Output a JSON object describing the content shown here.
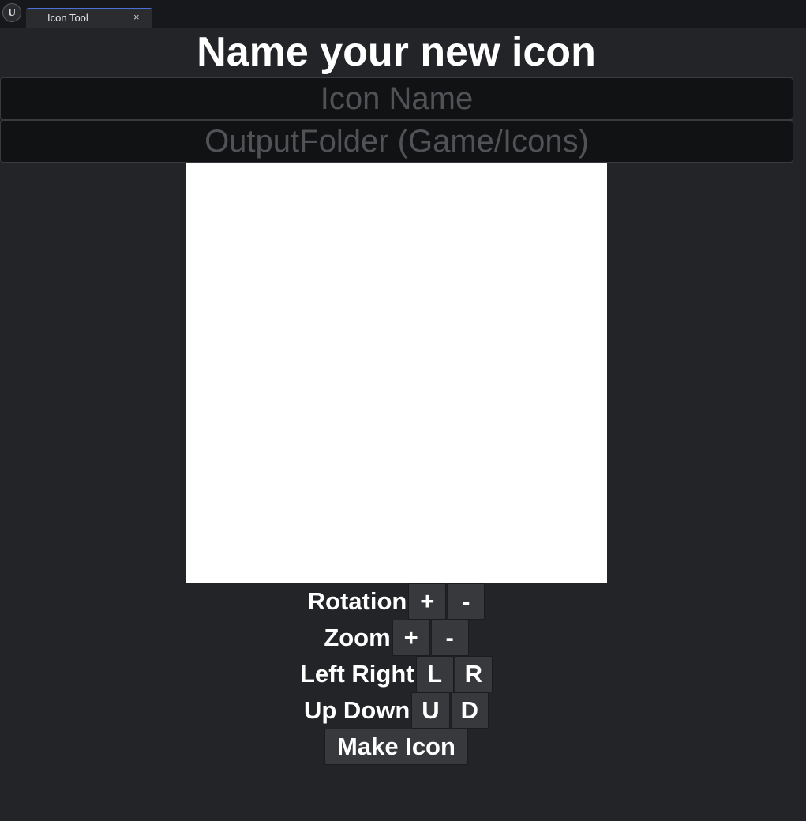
{
  "window": {
    "logo_glyph": "U",
    "tab_label": "Icon Tool",
    "tab_close_glyph": "×"
  },
  "heading": "Name your new icon",
  "fields": {
    "icon_name_placeholder": "Icon Name",
    "output_folder_placeholder": "OutputFolder (Game/Icons)"
  },
  "preview": {
    "background": "#ffffff"
  },
  "controls": {
    "rotation": {
      "label": "Rotation",
      "plus": "+",
      "minus": "-"
    },
    "zoom": {
      "label": "Zoom",
      "plus": "+",
      "minus": "-"
    },
    "left_right": {
      "label": "Left Right",
      "left": "L",
      "right": "R"
    },
    "up_down": {
      "label": "Up Down",
      "up": "U",
      "down": "D"
    },
    "make_icon": "Make Icon"
  },
  "colors": {
    "background": "#232427",
    "titlebar": "#17181b",
    "field_background": "#111213",
    "button_background": "#38393d",
    "tab_accent": "#4a6fd6"
  }
}
